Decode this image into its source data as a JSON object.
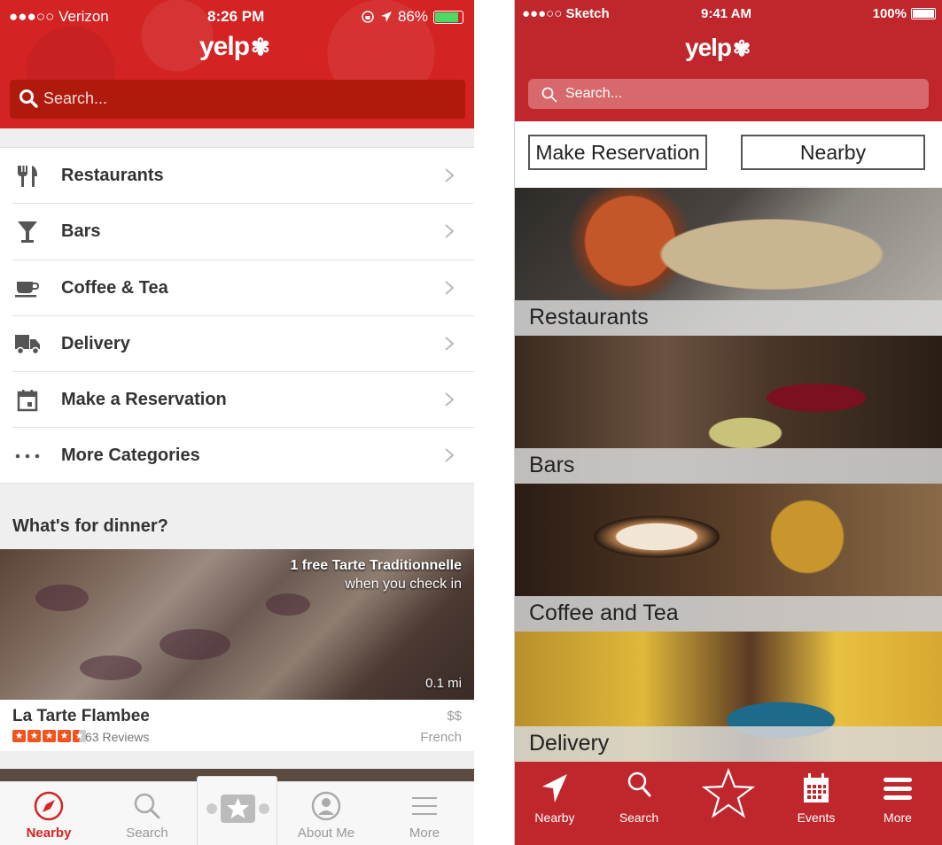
{
  "left": {
    "status": {
      "carrier": "●●●○○ Verizon",
      "time": "8:26 PM",
      "battery_pct": "86%",
      "battery_level": 0.86
    },
    "logo": "yelp",
    "search": {
      "placeholder": "Search..."
    },
    "categories": [
      {
        "label": "Restaurants",
        "icon": "fork-knife-icon"
      },
      {
        "label": "Bars",
        "icon": "cocktail-icon"
      },
      {
        "label": "Coffee & Tea",
        "icon": "coffee-cup-icon"
      },
      {
        "label": "Delivery",
        "icon": "delivery-truck-icon"
      },
      {
        "label": "Make a Reservation",
        "icon": "calendar-icon"
      },
      {
        "label": "More Categories",
        "icon": "ellipsis-icon"
      }
    ],
    "section_title": "What's for dinner?",
    "feature": {
      "promo_line1": "1 free Tarte Traditionnelle",
      "promo_line2": "when you check in",
      "distance": "0.1 mi",
      "name": "La Tarte Flambee",
      "price": "$$",
      "rating": 4.5,
      "reviews": "63 Reviews",
      "category": "French"
    },
    "tabs": [
      {
        "label": "Nearby",
        "active": true
      },
      {
        "label": "Search",
        "active": false
      },
      {
        "label": "About Me",
        "active": false
      },
      {
        "label": "More",
        "active": false
      }
    ],
    "colors": {
      "brand": "#d32323",
      "search_bg": "#b01a0c"
    }
  },
  "right": {
    "status": {
      "carrier": "●●●○○ Sketch",
      "time": "9:41 AM",
      "battery_pct": "100%"
    },
    "logo": "yelp",
    "search": {
      "placeholder": "Search..."
    },
    "buttons": {
      "reservation": "Make Reservation",
      "nearby": "Nearby"
    },
    "tiles": [
      {
        "label": "Restaurants"
      },
      {
        "label": "Bars"
      },
      {
        "label": "Coffee and Tea"
      },
      {
        "label": "Delivery"
      }
    ],
    "tabs": [
      {
        "label": "Nearby",
        "icon": "location-arrow-icon"
      },
      {
        "label": "Search",
        "icon": "search-icon"
      },
      {
        "label": "",
        "icon": "star-icon"
      },
      {
        "label": "Events",
        "icon": "calendar-icon"
      },
      {
        "label": "More",
        "icon": "menu-icon"
      }
    ],
    "colors": {
      "brand": "#c0272d"
    }
  }
}
